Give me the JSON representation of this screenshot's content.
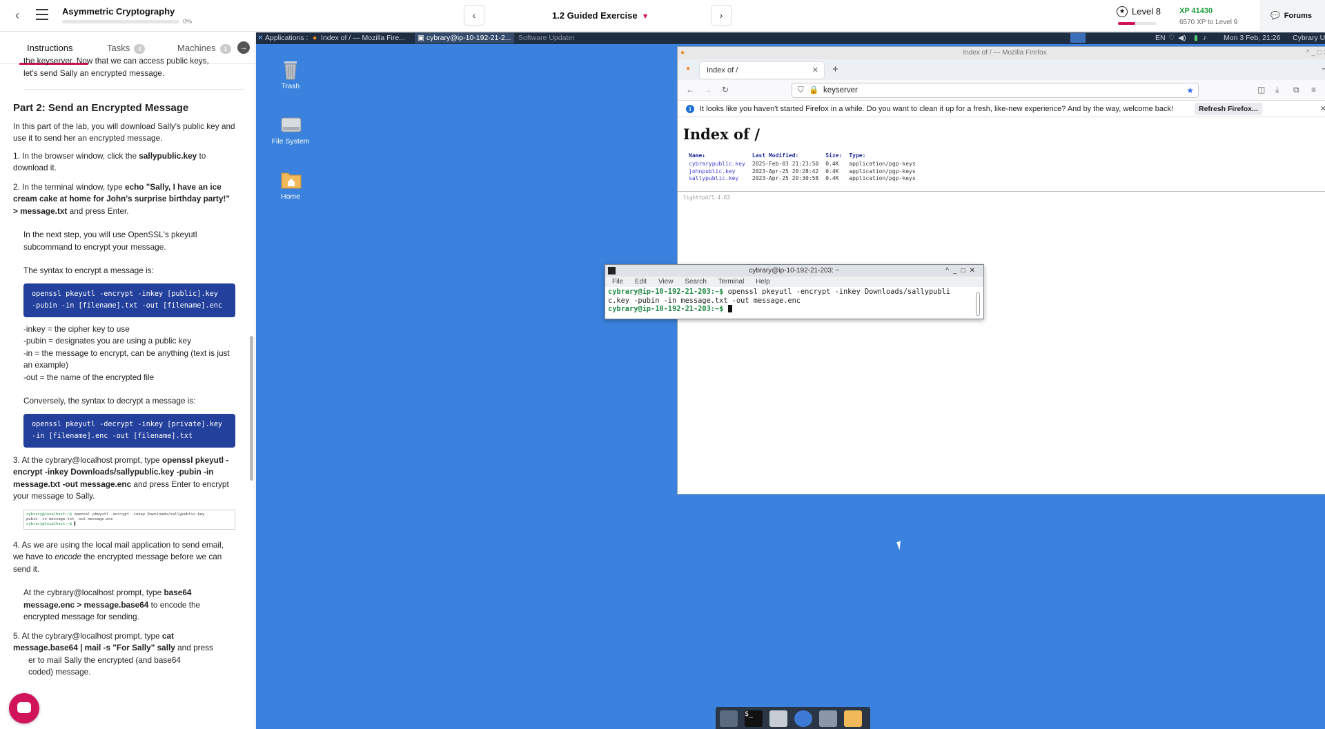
{
  "header": {
    "course_title": "Asymmetric Cryptography",
    "progress_pct": "0%",
    "progress_value": 0,
    "lesson_title": "1.2 Guided Exercise",
    "level_label": "Level 8",
    "level_progress": 0.45,
    "xp_label": "XP 41430",
    "xp_next": "6570 XP to Level 9",
    "forums_label": "Forums"
  },
  "tabs": [
    {
      "label": "Instructions"
    },
    {
      "label": "Tasks",
      "badge": "4"
    },
    {
      "label": "Machines",
      "badge": "1"
    }
  ],
  "instructions": {
    "intro_tail_1": "the keyserver. Now that we can access public keys,",
    "intro_tail_2": "let's send Sally an encrypted message.",
    "part2_title": "Part 2: Send an Encrypted Message",
    "part2_intro": "In this part of the lab, you will download Sally's public key and use it to send her an encrypted message.",
    "step1_a": "1. In the browser window, click the ",
    "step1_b": "sallypublic.key",
    "step1_c": " to download it.",
    "step2_a": "2. In the terminal window, type ",
    "step2_b": "echo \"Sally, I have an ice cream cake at home for John's surprise birthday party!\" > message.txt",
    "step2_c": " and press Enter.",
    "step2_next": "In the next step, you will use OpenSSL's pkeyutl subcommand to encrypt your message.",
    "syntax_enc_label": "The syntax to encrypt a message is:",
    "code_enc_1": "openssl pkeyutl -encrypt -inkey [public].key",
    "code_enc_2": "-pubin -in [filename].txt -out [filename].enc",
    "opt_inkey": "-inkey = the cipher key to use",
    "opt_pubin": "-pubin = designates you are using a public key",
    "opt_in": "-in = the message to encrypt, can be anything (text is just an example)",
    "opt_out": "-out = the name of the encrypted file",
    "syntax_dec_label": "Conversely, the syntax to decrypt a message is:",
    "code_dec_1": "openssl pkeyutl -decrypt -inkey [private].key",
    "code_dec_2": "-in [filename].enc -out [filename].txt",
    "step3_a": "3. At the cybrary@localhost prompt, type ",
    "step3_b": "openssl pkeyutl -encrypt -inkey Downloads/sallypublic.key -pubin -in message.txt -out message.enc",
    "step3_c": " and press Enter to encrypt your message to Sally.",
    "mini_prompt": "cybrary@localhost:~$",
    "mini_cmd_1": " openssl pkeyutl -encrypt -inkey Downloads/sallypublic.key -",
    "mini_cmd_2": "pubin -in message.txt -out message.enc",
    "mini_prompt2": "cybrary@localhost:~$",
    "step4_a": "4. As we are using the local mail application to send email, we have to ",
    "step4_em": "encode",
    "step4_c": " the encrypted message before we can send it.",
    "step4b_a": "At the cybrary@localhost prompt, type ",
    "step4b_b": "base64 message.enc > message.base64",
    "step4b_c": " to encode the encrypted message for sending.",
    "step5_a": "5. At the cybrary@localhost prompt, type ",
    "step5_b": "cat message.base64 | mail -s \"For Sally\" sally",
    "step5_c": " and press",
    "step5_d": "er to mail Sally the encrypted (and base64",
    "step5_e": "coded) message."
  },
  "xfce_panel": {
    "applications": "Applications :",
    "task_firefox": "Index of / — Mozilla Fire...",
    "task_terminal": "cybrary@ip-10-192-21-2...",
    "task_updater": "Software Updater",
    "lang": "EN",
    "clock": "Mon  3 Feb, 21:26",
    "user": "Cybrary Us"
  },
  "desktop_icons": [
    {
      "label": "Trash"
    },
    {
      "label": "File System"
    },
    {
      "label": "Home"
    }
  ],
  "firefox": {
    "window_title": "Index of / — Mozilla Firefox",
    "tab_title": "Index of /",
    "url": "keyserver",
    "notice": "It looks like you haven't started Firefox in a while. Do you want to clean it up for a fresh, like-new experience? And by the way, welcome back!",
    "refresh_label": "Refresh Firefox...",
    "page_heading": "Index of /",
    "columns": [
      "Name↓",
      "Last Modified:",
      "Size:",
      "Type:"
    ],
    "rows": [
      [
        "cybrarypublic.key",
        "2025-Feb-03 21:23:50",
        "0.4K",
        "application/pgp-keys"
      ],
      [
        "johnpublic.key",
        "2023-Apr-25 20:28:42",
        "0.4K",
        "application/pgp-keys"
      ],
      [
        "sallypublic.key",
        "2023-Apr-25 20:30:58",
        "0.4K",
        "application/pgp-keys"
      ]
    ],
    "footer": "lighttpd/1.4.63"
  },
  "terminal": {
    "title": "cybrary@ip-10-192-21-203: ~",
    "menu": [
      "File",
      "Edit",
      "View",
      "Search",
      "Terminal",
      "Help"
    ],
    "prompt": "cybrary@ip-10-192-21-203:~$",
    "cmd_1": " openssl pkeyutl -encrypt -inkey Downloads/sallypubli",
    "cmd_2": "c.key -pubin -in message.txt -out message.enc",
    "prompt2": "cybrary@ip-10-192-21-203:~$"
  },
  "colors": {
    "accent": "#d1135c",
    "desktop": "#3a82dd",
    "code_bg": "#23409c",
    "xp_green": "#1a9e3b"
  }
}
